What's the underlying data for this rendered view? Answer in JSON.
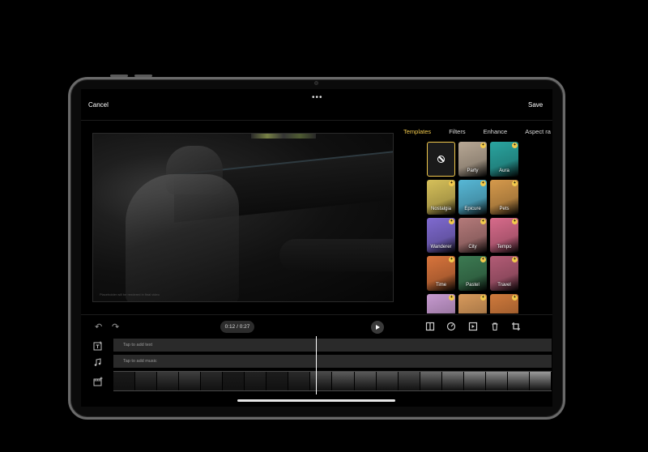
{
  "header": {
    "cancel_label": "Cancel",
    "more_label": "•••",
    "save_label": "Save"
  },
  "preview": {
    "caption": "Placeholder will be rendered in final video"
  },
  "tabs": [
    {
      "label": "Templates",
      "active": true
    },
    {
      "label": "Filters",
      "active": false
    },
    {
      "label": "Enhance",
      "active": false
    },
    {
      "label": "Aspect ra",
      "active": false
    }
  ],
  "templates": [
    {
      "name": "None",
      "label": "",
      "icon": "no-symbol-icon",
      "color": "#1a1a1a",
      "selected": true
    },
    {
      "name": "Party",
      "label": "Party",
      "color": "#b8a895",
      "badge": true
    },
    {
      "name": "Aura",
      "label": "Aura",
      "color": "#2aa5a0",
      "badge": true
    },
    {
      "name": "Nostalgia",
      "label": "Nostalgia",
      "color": "#d6c05a",
      "badge": true
    },
    {
      "name": "Epicure",
      "label": "Epicure",
      "color": "#57b8d6",
      "badge": true
    },
    {
      "name": "Pets",
      "label": "Pets",
      "color": "#d69a4c",
      "badge": true
    },
    {
      "name": "Wanderer",
      "label": "Wanderer",
      "color": "#7f6ad0",
      "badge": true
    },
    {
      "name": "City",
      "label": "City",
      "color": "#b47a7a",
      "badge": true
    },
    {
      "name": "Tempo",
      "label": "Tempo",
      "color": "#d86b8b",
      "badge": true
    },
    {
      "name": "Time",
      "label": "Time",
      "color": "#d8743c",
      "badge": true
    },
    {
      "name": "Pastel",
      "label": "Pastel",
      "color": "#3c7a52",
      "badge": true
    },
    {
      "name": "Travel",
      "label": "Travel",
      "color": "#b35c76",
      "badge": true
    },
    {
      "name": "More1",
      "label": "",
      "color": "#c79ad0",
      "badge": true
    },
    {
      "name": "More2",
      "label": "",
      "color": "#d89a5c",
      "badge": true
    },
    {
      "name": "More3",
      "label": "",
      "color": "#d07a3c",
      "badge": true
    }
  ],
  "controls": {
    "time": "0:12 / 0:27",
    "undo_icon": "undo-icon",
    "redo_icon": "redo-icon",
    "play_icon": "play-icon",
    "tools": [
      "split-icon",
      "speed-icon",
      "replace-icon",
      "delete-icon",
      "crop-icon"
    ]
  },
  "timeline": {
    "text_placeholder": "Tap to add text",
    "music_placeholder": "Tap to add music",
    "frame_colors": [
      "#1a1a1a",
      "#2e2e2e",
      "#3a3a3a",
      "#3f3f3f",
      "#2a2a2a",
      "#1a1a1a",
      "#222",
      "#1c1c1c",
      "#2a2a2a",
      "#4a4a4a",
      "#5b5b5b",
      "#5a5a5a",
      "#555",
      "#4c4c4c",
      "#6a6a6a",
      "#7a7a7a",
      "#8a8a8a",
      "#8d8d8d",
      "#909090",
      "#9a9a9a"
    ]
  }
}
